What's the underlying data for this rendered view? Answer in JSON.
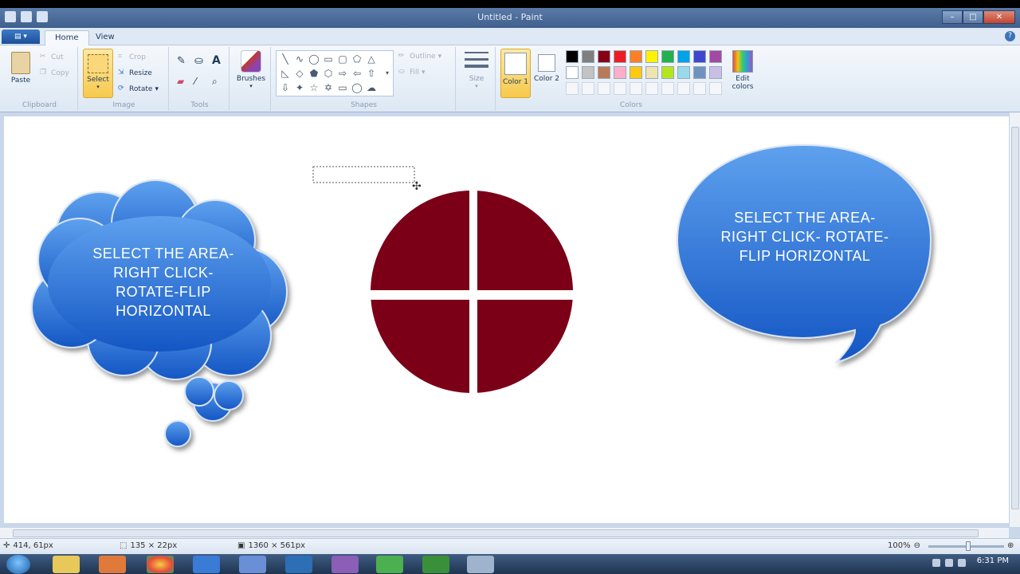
{
  "window": {
    "title": "Untitled - Paint"
  },
  "tabs": {
    "app_menu": "",
    "home": "Home",
    "view": "View"
  },
  "ribbon": {
    "clipboard": {
      "label": "Clipboard",
      "paste": "Paste",
      "cut": "Cut",
      "copy": "Copy"
    },
    "image": {
      "label": "Image",
      "select": "Select",
      "crop": "Crop",
      "resize": "Resize",
      "rotate": "Rotate"
    },
    "tools": {
      "label": "Tools"
    },
    "brushes": {
      "label": "Brushes"
    },
    "shapes": {
      "label": "Shapes",
      "outline": "Outline",
      "fill": "Fill"
    },
    "size": {
      "label": "Size"
    },
    "colors": {
      "label": "Colors",
      "color1": "Color 1",
      "color2": "Color 2",
      "edit_colors": "Edit colors",
      "row1": [
        "#000000",
        "#7f7f7f",
        "#880015",
        "#ed1c24",
        "#ff7f27",
        "#fff200",
        "#22b14c",
        "#00a2e8",
        "#3f48cc",
        "#a349a4"
      ],
      "row2": [
        "#ffffff",
        "#c3c3c3",
        "#b97a57",
        "#ffaec9",
        "#ffc90e",
        "#efe4b0",
        "#b5e61d",
        "#99d9ea",
        "#7092be",
        "#c8bfe7"
      ]
    }
  },
  "canvas": {
    "cloud_text": [
      "SELECT THE AREA-",
      "RIGHT CLICK-",
      "ROTATE-FLIP",
      "HORIZONTAL"
    ],
    "speech_text": [
      "SELECT THE AREA-",
      "RIGHT CLICK- ROTATE-",
      "FLIP HORIZONTAL"
    ],
    "circle_color": "#7b0017",
    "bubble_color": "#1f6fd8"
  },
  "statusbar": {
    "cursor_pos": "414, 61px",
    "selection_size": "135 × 22px",
    "image_size": "1360 × 561px",
    "zoom": "100%"
  },
  "taskbar": {
    "time": "6:31 PM"
  }
}
